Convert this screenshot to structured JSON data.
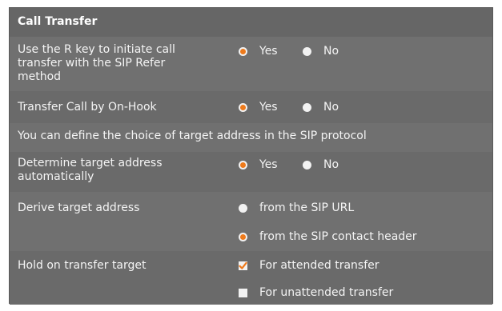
{
  "section": {
    "title": "Call Transfer"
  },
  "rows": {
    "r_key": {
      "label_lines": [
        "Use the R key to initiate call",
        "transfer with the SIP Refer",
        "method"
      ],
      "yes": "Yes",
      "no": "No",
      "selected": "yes"
    },
    "on_hook": {
      "label": "Transfer Call by On-Hook",
      "yes": "Yes",
      "no": "No",
      "selected": "yes"
    },
    "info": "You can define the choice of target address in the SIP protocol",
    "determine": {
      "label_lines": [
        "Determine target address",
        "automatically"
      ],
      "yes": "Yes",
      "no": "No",
      "selected": "yes"
    },
    "derive": {
      "label": "Derive target address",
      "options": [
        "from the SIP URL",
        "from the SIP contact header"
      ],
      "selected_index": 1
    },
    "hold": {
      "label": "Hold on transfer target",
      "options": [
        "For attended transfer",
        "For unattended transfer"
      ],
      "checked": [
        true,
        false
      ]
    }
  },
  "colors": {
    "accent": "#ee7a1b",
    "panel": "#6e6e6e",
    "text": "#f4f4f4"
  }
}
